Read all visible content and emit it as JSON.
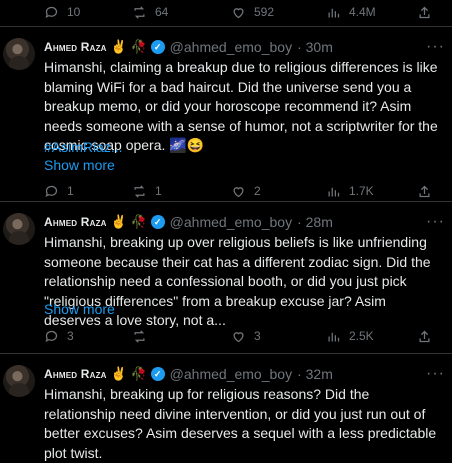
{
  "top_actions": {
    "replies": "10",
    "reposts": "64",
    "likes": "592",
    "views": "4.4M"
  },
  "tweets": [
    {
      "name": "Ahmed Raza",
      "emojis": "✌️ 🥀",
      "handle": "@ahmed_emo_boy",
      "time": "· 30m",
      "text": "Himanshi, claiming a breakup due to religious differences is like blaming WiFi for a bad haircut. Did the universe send you a breakup memo, or did your horoscope recommend it? Asim needs someone with a sense of humor, not a scriptwriter for the cosmic soap opera. 🌌😆",
      "hashtag": "#AsimRiaz...",
      "show_more": "Show more",
      "replies": "1",
      "reposts": "1",
      "likes": "2",
      "views": "1.7K"
    },
    {
      "name": "Ahmed Raza",
      "emojis": "✌️ 🥀",
      "handle": "@ahmed_emo_boy",
      "time": "· 28m",
      "text": "Himanshi, breaking up over religious beliefs is like unfriending someone because their cat has a different zodiac sign. Did the relationship need a confessional booth, or did you just pick \"religious differences\" from a breakup excuse jar? Asim deserves a love story, not a...",
      "show_more": "Show more",
      "replies": "3",
      "reposts": "",
      "likes": "3",
      "views": "2.5K"
    },
    {
      "name": "Ahmed Raza",
      "emojis": "✌️ 🥀",
      "handle": "@ahmed_emo_boy",
      "time": "· 32m",
      "text": "Himanshi, breaking up for religious reasons? Did the relationship need divine intervention, or did you just run out of better excuses? Asim deserves a sequel with a less predictable plot twist."
    }
  ],
  "colors": {
    "accent": "#1d9bf0",
    "muted": "#71767b",
    "text": "#e7e9ea",
    "border": "#2f3336"
  }
}
